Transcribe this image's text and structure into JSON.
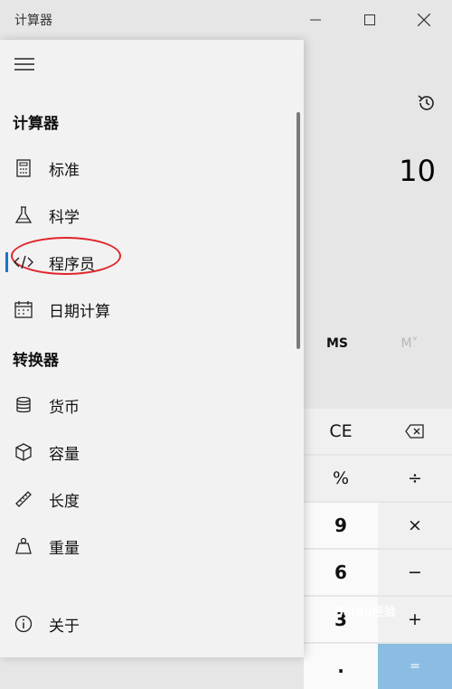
{
  "window": {
    "title": "计算器",
    "controls": {
      "minimize": "minimize-icon",
      "maximize": "maximize-icon",
      "close": "close-icon"
    }
  },
  "calculator": {
    "display_value": "10",
    "memory": {
      "ms": "MS",
      "mv": "M˅"
    },
    "keys": [
      {
        "label": "CE",
        "kind": "op"
      },
      {
        "label": "backspace",
        "kind": "op",
        "icon": "backspace-icon"
      },
      {
        "label": "%",
        "kind": "op"
      },
      {
        "label": "÷",
        "kind": "op"
      },
      {
        "label": "9",
        "kind": "num"
      },
      {
        "label": "×",
        "kind": "op"
      },
      {
        "label": "6",
        "kind": "num"
      },
      {
        "label": "−",
        "kind": "op"
      },
      {
        "label": "3",
        "kind": "num"
      },
      {
        "label": "+",
        "kind": "op"
      },
      {
        "label": ".",
        "kind": "num"
      },
      {
        "label": "=",
        "kind": "eq"
      }
    ]
  },
  "nav": {
    "calculator_section": "计算器",
    "calculator_items": [
      {
        "label": "标准",
        "icon": "calculator-icon"
      },
      {
        "label": "科学",
        "icon": "flask-icon"
      },
      {
        "label": "程序员",
        "icon": "code-icon",
        "selected": true
      },
      {
        "label": "日期计算",
        "icon": "calendar-icon"
      }
    ],
    "converter_section": "转换器",
    "converter_items": [
      {
        "label": "货币",
        "icon": "coins-icon"
      },
      {
        "label": "容量",
        "icon": "cube-icon"
      },
      {
        "label": "长度",
        "icon": "ruler-icon"
      },
      {
        "label": "重量",
        "icon": "weight-icon"
      }
    ],
    "about": {
      "label": "关于",
      "icon": "info-icon"
    }
  },
  "colors": {
    "accent": "#1a73c9",
    "annotation": "#e0252b",
    "equals_key": "#8bbde2"
  },
  "watermark": "Baidu经验"
}
